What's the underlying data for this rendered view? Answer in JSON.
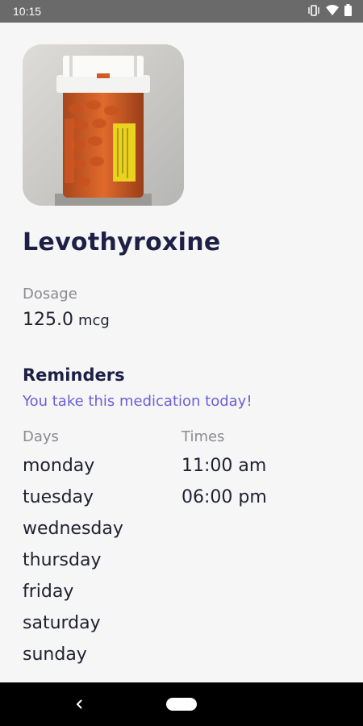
{
  "status_bar": {
    "time": "10:15"
  },
  "medication": {
    "name": "Levothyroxine",
    "dosage_label": "Dosage",
    "dosage_value": "125.0",
    "dosage_unit": "mcg"
  },
  "reminders": {
    "title": "Reminders",
    "note": "You take this medication today!",
    "days_label": "Days",
    "times_label": "Times",
    "days": [
      "monday",
      "tuesday",
      "wednesday",
      "thursday",
      "friday",
      "saturday",
      "sunday"
    ],
    "times": [
      "11:00 am",
      "06:00 pm"
    ]
  },
  "colors": {
    "title": "#1d1f45",
    "accent": "#6a5fd3",
    "muted": "#8b8b90",
    "status_bar": "#6a6a6a"
  },
  "icons": [
    "vibrate-icon",
    "wifi-icon",
    "battery-icon",
    "back-icon",
    "home-icon"
  ]
}
